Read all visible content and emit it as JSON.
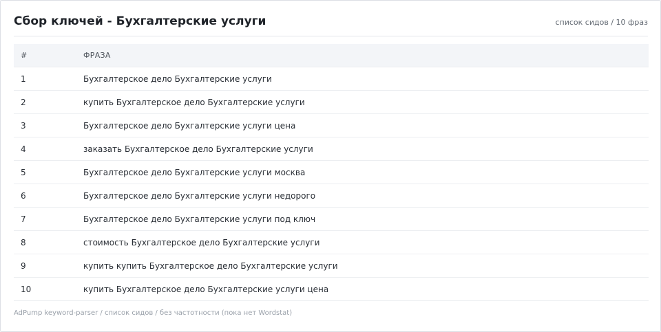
{
  "header": {
    "title": "Сбор ключей - Бухгалтерские услуги",
    "meta": "список сидов / 10 фраз"
  },
  "table": {
    "columns": [
      "#",
      "ФРАЗА"
    ],
    "rows": [
      {
        "num": "1",
        "phrase": "Бухгалтерское дело Бухгалтерские услуги"
      },
      {
        "num": "2",
        "phrase": "купить Бухгалтерское дело Бухгалтерские услуги"
      },
      {
        "num": "3",
        "phrase": "Бухгалтерское дело Бухгалтерские услуги цена"
      },
      {
        "num": "4",
        "phrase": "заказать Бухгалтерское дело Бухгалтерские услуги"
      },
      {
        "num": "5",
        "phrase": "Бухгалтерское дело Бухгалтерские услуги москва"
      },
      {
        "num": "6",
        "phrase": "Бухгалтерское дело Бухгалтерские услуги недорого"
      },
      {
        "num": "7",
        "phrase": "Бухгалтерское дело Бухгалтерские услуги под ключ"
      },
      {
        "num": "8",
        "phrase": "стоимость Бухгалтерское дело Бухгалтерские услуги"
      },
      {
        "num": "9",
        "phrase": "купить купить Бухгалтерское дело Бухгалтерские услуги"
      },
      {
        "num": "10",
        "phrase": "купить Бухгалтерское дело Бухгалтерские услуги цена"
      }
    ]
  },
  "footer": {
    "text": "AdPump keyword-parser / список сидов / без частотности (пока нет Wordstat)"
  }
}
